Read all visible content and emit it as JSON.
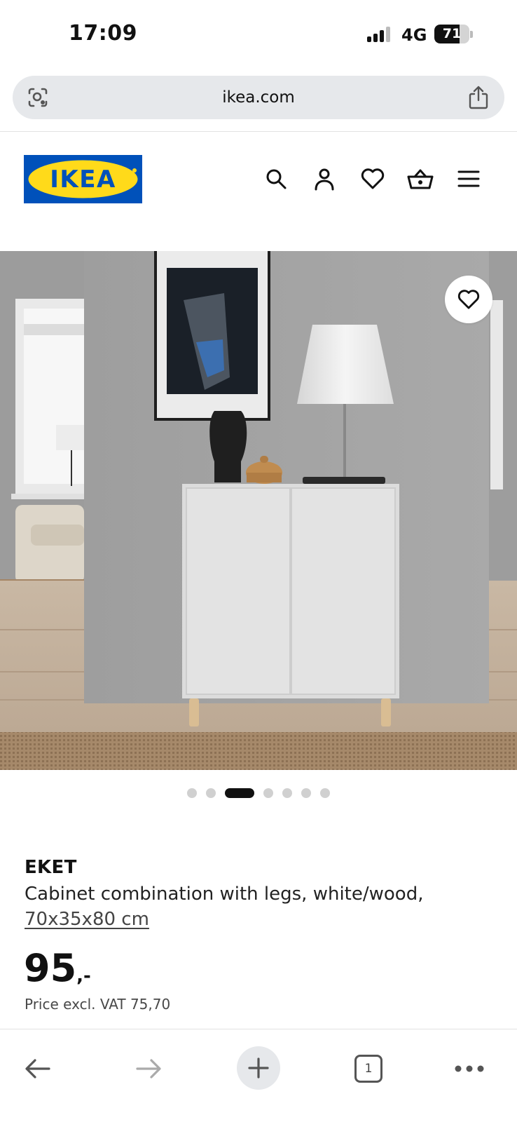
{
  "status_bar": {
    "time": "17:09",
    "network": "4G",
    "battery_percent": "71",
    "battery_level": 0.71,
    "signal_bars_active": 3
  },
  "browser": {
    "url": "ikea.com",
    "icons": [
      "lens-icon",
      "share-icon"
    ]
  },
  "header": {
    "logo_text": "IKEA",
    "colors": {
      "logo_blue": "#0051ba",
      "logo_yellow": "#ffda1a"
    },
    "icons": [
      "search-icon",
      "account-icon",
      "heart-icon",
      "basket-icon",
      "menu-icon"
    ]
  },
  "gallery": {
    "total_images": 7,
    "active_index": 2,
    "favourite_icon": "heart-icon"
  },
  "product": {
    "name": "EKET",
    "description": "Cabinet combination with legs, white/wood,",
    "dimensions": "70x35x80 cm",
    "price": "95",
    "price_suffix": ",-",
    "price_excl_vat": "Price excl. VAT 75,70"
  },
  "toolbar": {
    "tab_count": "1",
    "icons": [
      "back-icon",
      "forward-icon",
      "new-tab-icon",
      "tabs-icon",
      "more-icon"
    ]
  }
}
